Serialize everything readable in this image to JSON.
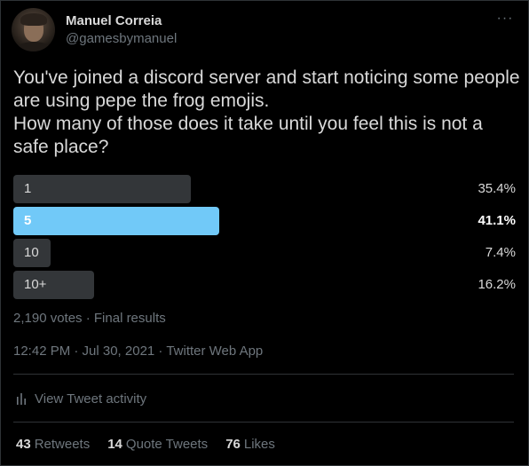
{
  "author": {
    "name": "Manuel Correia",
    "handle": "@gamesbymanuel"
  },
  "menu": {
    "more_glyph": "···"
  },
  "tweet": {
    "text": "You've joined a discord server and start noticing some people are using pepe the frog emojis.\nHow many of those does it take until you feel this is not a safe place?"
  },
  "poll": {
    "options": [
      {
        "label": "1",
        "percent_text": "35.4%",
        "percent": 35.4,
        "winner": false
      },
      {
        "label": "5",
        "percent_text": "41.1%",
        "percent": 41.1,
        "winner": true
      },
      {
        "label": "10",
        "percent_text": "7.4%",
        "percent": 7.4,
        "winner": false
      },
      {
        "label": "10+",
        "percent_text": "16.2%",
        "percent": 16.2,
        "winner": false
      }
    ],
    "meta": "2,190 votes · Final results"
  },
  "timestamp": "12:42 PM · Jul 30, 2021 · Twitter Web App",
  "activity": {
    "label": "View Tweet activity",
    "icon": "bar-chart-icon"
  },
  "stats": {
    "retweets": {
      "count": "43",
      "label": "Retweets"
    },
    "quote_tweets": {
      "count": "14",
      "label": "Quote Tweets"
    },
    "likes": {
      "count": "76",
      "label": "Likes"
    }
  },
  "colors": {
    "background": "#000000",
    "winner_bar": "#71c9f8",
    "bar": "#333639",
    "muted_text": "#6e767d",
    "text": "#d9d9d9",
    "divider": "#2f3336"
  }
}
